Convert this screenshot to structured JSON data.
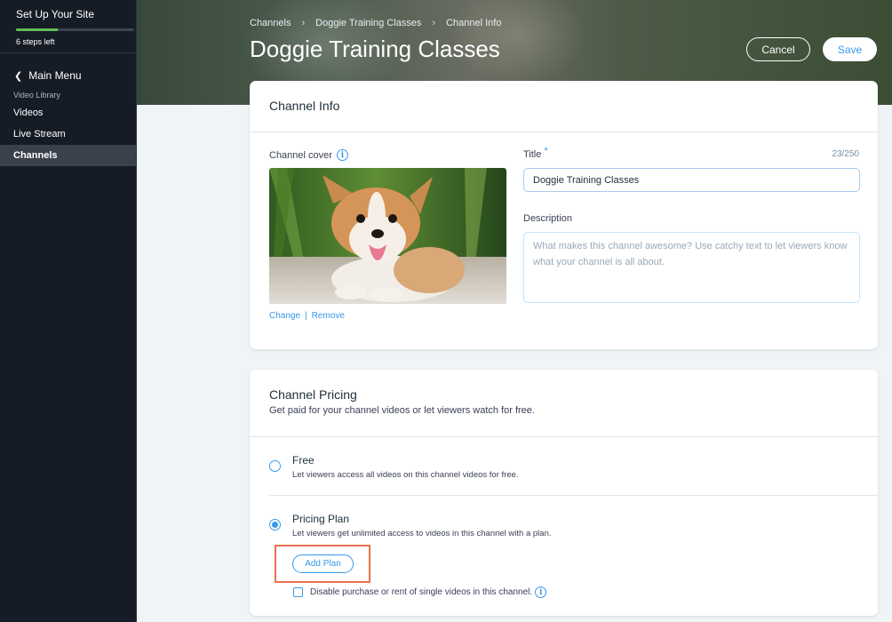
{
  "sidebar": {
    "setup_title": "Set Up Your Site",
    "steps_left": "6 steps left",
    "setup_progress_percent": 35,
    "main_menu": "Main Menu",
    "section_label": "Video Library",
    "items": [
      {
        "label": "Videos",
        "active": false
      },
      {
        "label": "Live Stream",
        "active": false
      },
      {
        "label": "Channels",
        "active": true
      }
    ]
  },
  "header": {
    "breadcrumb": [
      "Channels",
      "Doggie Training Classes",
      "Channel Info"
    ],
    "title": "Doggie Training Classes",
    "cancel_label": "Cancel",
    "save_label": "Save"
  },
  "channel_info": {
    "heading": "Channel Info",
    "cover_label": "Channel cover",
    "change_link": "Change",
    "link_divider": "|",
    "remove_link": "Remove",
    "title_label": "Title",
    "required_mark": "*",
    "title_counter": "23/250",
    "title_value": "Doggie Training Classes",
    "description_label": "Description",
    "description_placeholder": "What makes this channel awesome? Use catchy text to let viewers know what your channel is all about."
  },
  "channel_pricing": {
    "heading": "Channel Pricing",
    "subheading": "Get paid for your channel videos or let viewers watch for free.",
    "options": [
      {
        "title": "Free",
        "description": "Let viewers access all videos on this channel videos for free.",
        "selected": false
      },
      {
        "title": "Pricing Plan",
        "description": "Let viewers get unlimited access to videos in this channel with a plan.",
        "selected": true
      }
    ],
    "add_plan_label": "Add Plan",
    "disable_single_label": "Disable purchase or rent of single videos in this channel.",
    "disable_single_checked": false
  },
  "colors": {
    "accent": "#3899ec",
    "highlight": "#e8714f",
    "sidebar_bg": "#161c26",
    "progress": "#60bc57"
  },
  "icons": {
    "info": "info-icon",
    "back": "chevron-left-icon",
    "breadcrumb_separator": "chevron-right-icon"
  }
}
